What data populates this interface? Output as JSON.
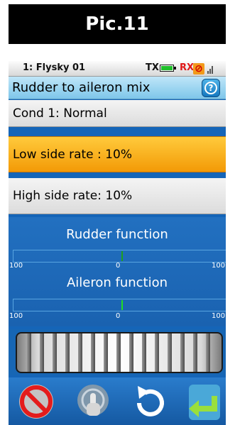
{
  "caption": "Pic.11",
  "status": {
    "model": "1: Flysky 01",
    "tx_label": "TX",
    "rx_label": "RX"
  },
  "title": {
    "text": "Rudder to aileron mix",
    "help_icon": "help-icon"
  },
  "condition": "Cond 1: Normal",
  "low_side_rate": "Low side rate : 10%",
  "high_side_rate": "High side rate: 10%",
  "rudder_function": {
    "label": "Rudder function",
    "scale_left": "100",
    "scale_center": "0",
    "scale_right": "100"
  },
  "aileron_function": {
    "label": "Aileron function",
    "scale_left": "100",
    "scale_center": "0",
    "scale_right": "100"
  },
  "toolbar": [
    "disable-icon",
    "touch-icon",
    "reset-icon",
    "return-icon"
  ],
  "colors": {
    "screen_bg": "#1565b8",
    "selected_row": "#f5a623",
    "bar_marker": "#22dd22"
  }
}
